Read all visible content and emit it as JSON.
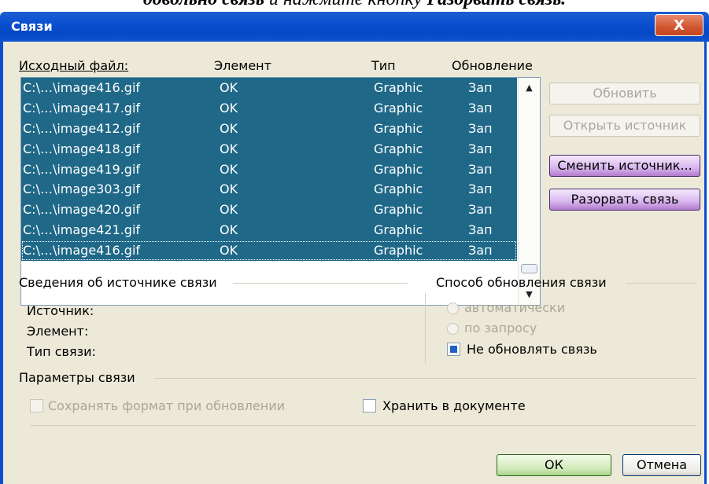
{
  "doc": {
    "italic_text": "довольно связь",
    "normal_text": "и нажмите кнопку",
    "bold_italic_text": "Разорвать связь."
  },
  "window": {
    "title": "Связи",
    "close_symbol": "X"
  },
  "list": {
    "headers": {
      "source_file": "Исходный файл:",
      "element": "Элемент",
      "type": "Тип",
      "update": "Обновление"
    },
    "rows": [
      {
        "file": "C:\\…\\image416.gif",
        "element": "OK",
        "type": "Graphic",
        "update": "Зап"
      },
      {
        "file": "C:\\…\\image417.gif",
        "element": "OK",
        "type": "Graphic",
        "update": "Зап"
      },
      {
        "file": "C:\\…\\image412.gif",
        "element": "OK",
        "type": "Graphic",
        "update": "Зап"
      },
      {
        "file": "C:\\…\\image418.gif",
        "element": "OK",
        "type": "Graphic",
        "update": "Зап"
      },
      {
        "file": "C:\\…\\image419.gif",
        "element": "OK",
        "type": "Graphic",
        "update": "Зап"
      },
      {
        "file": "C:\\…\\image303.gif",
        "element": "OK",
        "type": "Graphic",
        "update": "Зап"
      },
      {
        "file": "C:\\…\\image420.gif",
        "element": "OK",
        "type": "Graphic",
        "update": "Зап"
      },
      {
        "file": "C:\\…\\image421.gif",
        "element": "OK",
        "type": "Graphic",
        "update": "Зап"
      },
      {
        "file": "C:\\…\\image416.gif",
        "element": "OK",
        "type": "Graphic",
        "update": "Зап"
      }
    ],
    "scroll_up": "▲",
    "scroll_down": "▼"
  },
  "buttons": {
    "update": "Обновить",
    "open_source": "Открыть источник",
    "change_source": "Сменить источник...",
    "break_link": "Разорвать связь",
    "ok": "ОК",
    "cancel": "Отмена"
  },
  "source_info": {
    "title": "Сведения об источнике связи",
    "source_label": "Источник:",
    "element_label": "Элемент:",
    "link_type_label": "Тип связи:"
  },
  "update_method": {
    "title": "Способ обновления связи",
    "automatic": "автоматически",
    "on_request": "по запросу",
    "no_update": "Не обновлять связь"
  },
  "link_params": {
    "title": "Параметры связи",
    "keep_format": "Сохранять формат при обновлении",
    "store_in_doc": "Хранить в документе"
  }
}
